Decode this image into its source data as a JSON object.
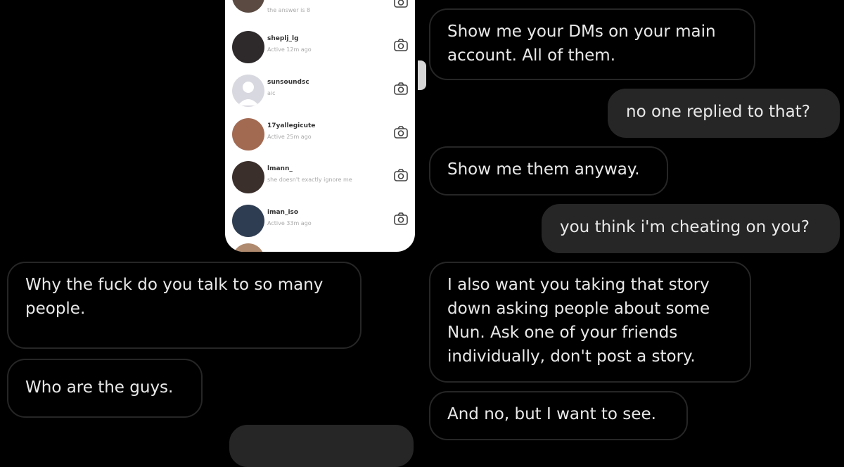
{
  "dm_screenshot": {
    "rows": [
      {
        "username": "",
        "status": "the answer is 8",
        "avatar_color": "#5a4a42"
      },
      {
        "username": "sheplj_lg",
        "status": "Active 12m ago",
        "avatar_color": "#2e2a2c"
      },
      {
        "username": "sunsoundsc",
        "status": "aic",
        "avatar_color": "#d8d8e0"
      },
      {
        "username": "17yallegicute",
        "status": "Active 25m ago",
        "avatar_color": "#a36a52"
      },
      {
        "username": "lmann_",
        "status": "she doesn't exactly ignore me",
        "avatar_color": "#3b2f2c"
      },
      {
        "username": "iman_iso",
        "status": "Active 33m ago",
        "avatar_color": "#2f3d52"
      }
    ]
  },
  "messages": [
    {
      "id": "m1",
      "side": "received",
      "text": "Show me your DMs on your main\naccount. All of them."
    },
    {
      "id": "m2",
      "side": "sent",
      "text": "no one replied to that?"
    },
    {
      "id": "m3",
      "side": "received",
      "text": "Show me them anyway."
    },
    {
      "id": "m4",
      "side": "sent",
      "text": "you think i'm cheating on you?"
    },
    {
      "id": "m5",
      "side": "received",
      "text": "Why the fuck do you talk to so many\npeople."
    },
    {
      "id": "m6",
      "side": "received",
      "text": "I also want you taking that story\ndown asking people about some\nNun. Ask one of your friends\nindividually, don't post a story."
    },
    {
      "id": "m7",
      "side": "received",
      "text": "Who are the guys."
    },
    {
      "id": "m8",
      "side": "received",
      "text": "And no, but I want to see."
    }
  ]
}
